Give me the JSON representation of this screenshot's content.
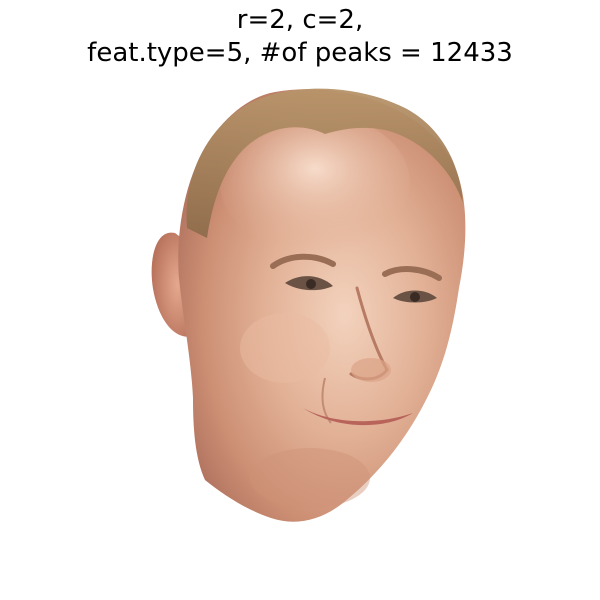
{
  "figure": {
    "title_line_1": "r=2, c=2,",
    "title_line_2": "feat.type=5, #of peaks = 12433"
  },
  "colors": {
    "background": "#ffffff",
    "text": "#000000",
    "skin_base": "#d9a48a",
    "skin_highlight": "#f1cdb8",
    "skin_shadow": "#b57a63",
    "hair": "#a8865f",
    "lips": "#b8645a",
    "eye": "#5a4a40"
  }
}
